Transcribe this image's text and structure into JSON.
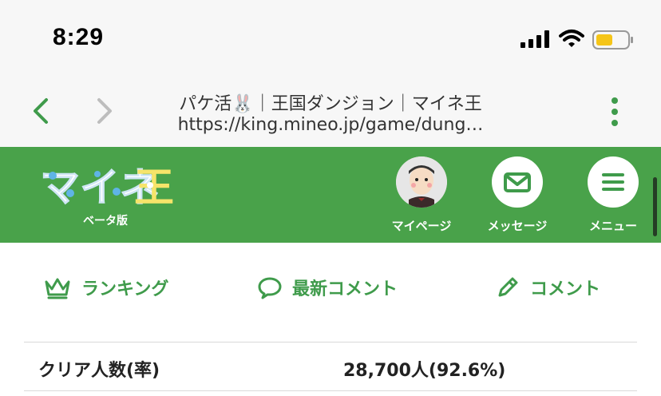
{
  "status_bar": {
    "time": "8:29",
    "battery_color": "#f5c518"
  },
  "browser": {
    "page_title": "パケ活🐰｜王国ダンジョン｜マイネ王",
    "url": "https://king.mineo.jp/game/dung…"
  },
  "site_header": {
    "background_color": "#49a24a",
    "logo_text": "マイネ王",
    "beta_label": "ベータ版",
    "buttons": [
      {
        "label": "マイページ",
        "icon": "avatar-icon"
      },
      {
        "label": "メッセージ",
        "icon": "envelope-icon"
      },
      {
        "label": "メニュー",
        "icon": "hamburger-icon"
      }
    ]
  },
  "actions": [
    {
      "label": "ランキング",
      "icon": "crown-icon"
    },
    {
      "label": "最新コメント",
      "icon": "speech-bubble-icon"
    },
    {
      "label": "コメント",
      "icon": "pencil-icon"
    }
  ],
  "accent_color": "#3f9b4b",
  "stats": [
    {
      "label": "クリア人数(率)",
      "value": "28,700人(92.6%)"
    }
  ]
}
